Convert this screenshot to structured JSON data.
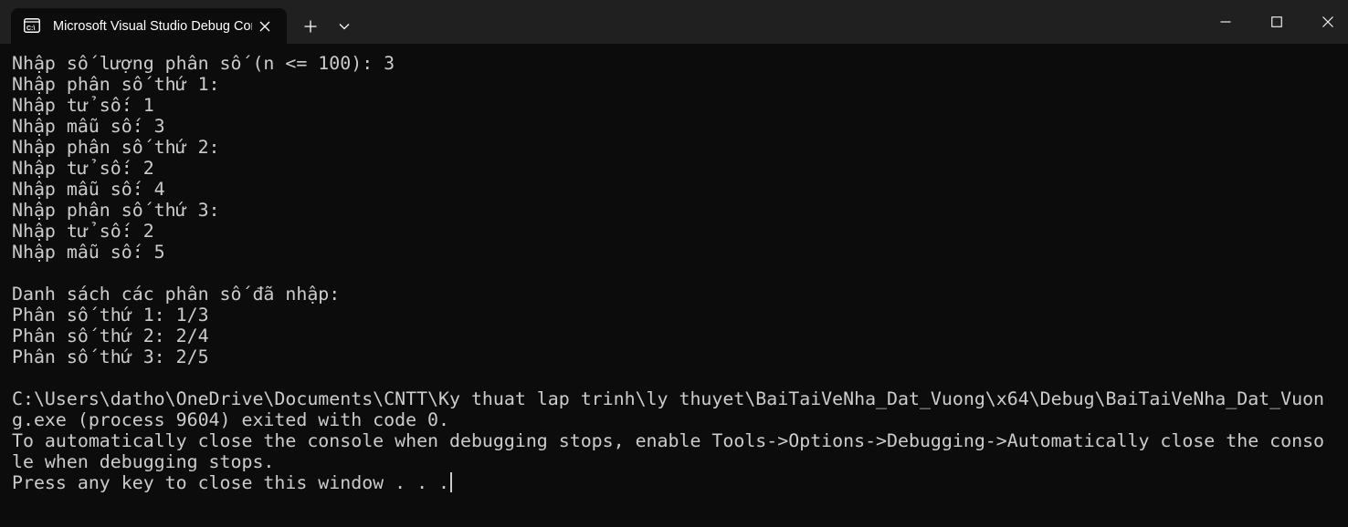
{
  "window": {
    "tab_title": "Microsoft Visual Studio Debug Console",
    "tab_icon": "console-icon",
    "background_color": "#0c0c0c",
    "titlebar_color": "#202020",
    "text_color": "#cccccc"
  },
  "console": {
    "lines": [
      "Nhập số lượng phân số (n <= 100): 3",
      "Nhập phân số thứ 1:",
      "Nhập tử số: 1",
      "Nhập mẫu số: 3",
      "Nhập phân số thứ 2:",
      "Nhập tử số: 2",
      "Nhập mẫu số: 4",
      "Nhập phân số thứ 3:",
      "Nhập tử số: 2",
      "Nhập mẫu số: 5",
      "",
      "Danh sách các phân số đã nhập:",
      "Phân số thứ 1: 1/3",
      "Phân số thứ 2: 2/4",
      "Phân số thứ 3: 2/5",
      "",
      "C:\\Users\\datho\\OneDrive\\Documents\\CNTT\\Ky thuat lap trinh\\ly thuyet\\BaiTaiVeNha_Dat_Vuong\\x64\\Debug\\BaiTaiVeNha_Dat_Vuon",
      "g.exe (process 9604) exited with code 0.",
      "To automatically close the console when debugging stops, enable Tools->Options->Debugging->Automatically close the conso",
      "le when debugging stops.",
      "Press any key to close this window . . ."
    ]
  }
}
